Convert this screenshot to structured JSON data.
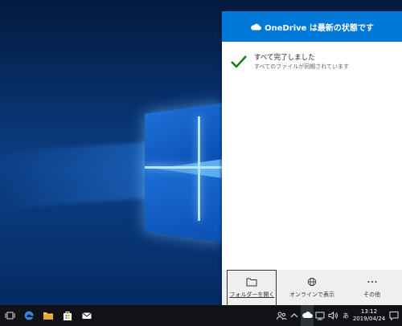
{
  "flyout": {
    "header_title": "OneDrive は最新の状態です",
    "status_title": "すべて完了しました",
    "status_subtitle": "すべてのファイルが同期されています",
    "actions": [
      {
        "label": "フォルダーを開く",
        "icon": "folder-icon"
      },
      {
        "label": "オンラインで表示",
        "icon": "globe-icon"
      },
      {
        "label": "その他",
        "icon": "more-icon"
      }
    ]
  },
  "taskbar": {
    "apps": [
      {
        "name": "task-view",
        "icon": "task-view-icon"
      },
      {
        "name": "edge",
        "icon": "edge-icon"
      },
      {
        "name": "file-explorer",
        "icon": "folder-icon"
      },
      {
        "name": "store",
        "icon": "store-icon"
      },
      {
        "name": "mail",
        "icon": "mail-icon"
      }
    ],
    "tray_icons": [
      "people-icon",
      "chevron-up-icon",
      "onedrive-cloud-icon",
      "network-icon",
      "volume-icon",
      "ime-icon"
    ],
    "ime_text": "あ",
    "time": "13:12",
    "date": "2019/04/24"
  },
  "colors": {
    "accent": "#0078d7",
    "check": "#107c10",
    "taskbar": "#101216"
  }
}
